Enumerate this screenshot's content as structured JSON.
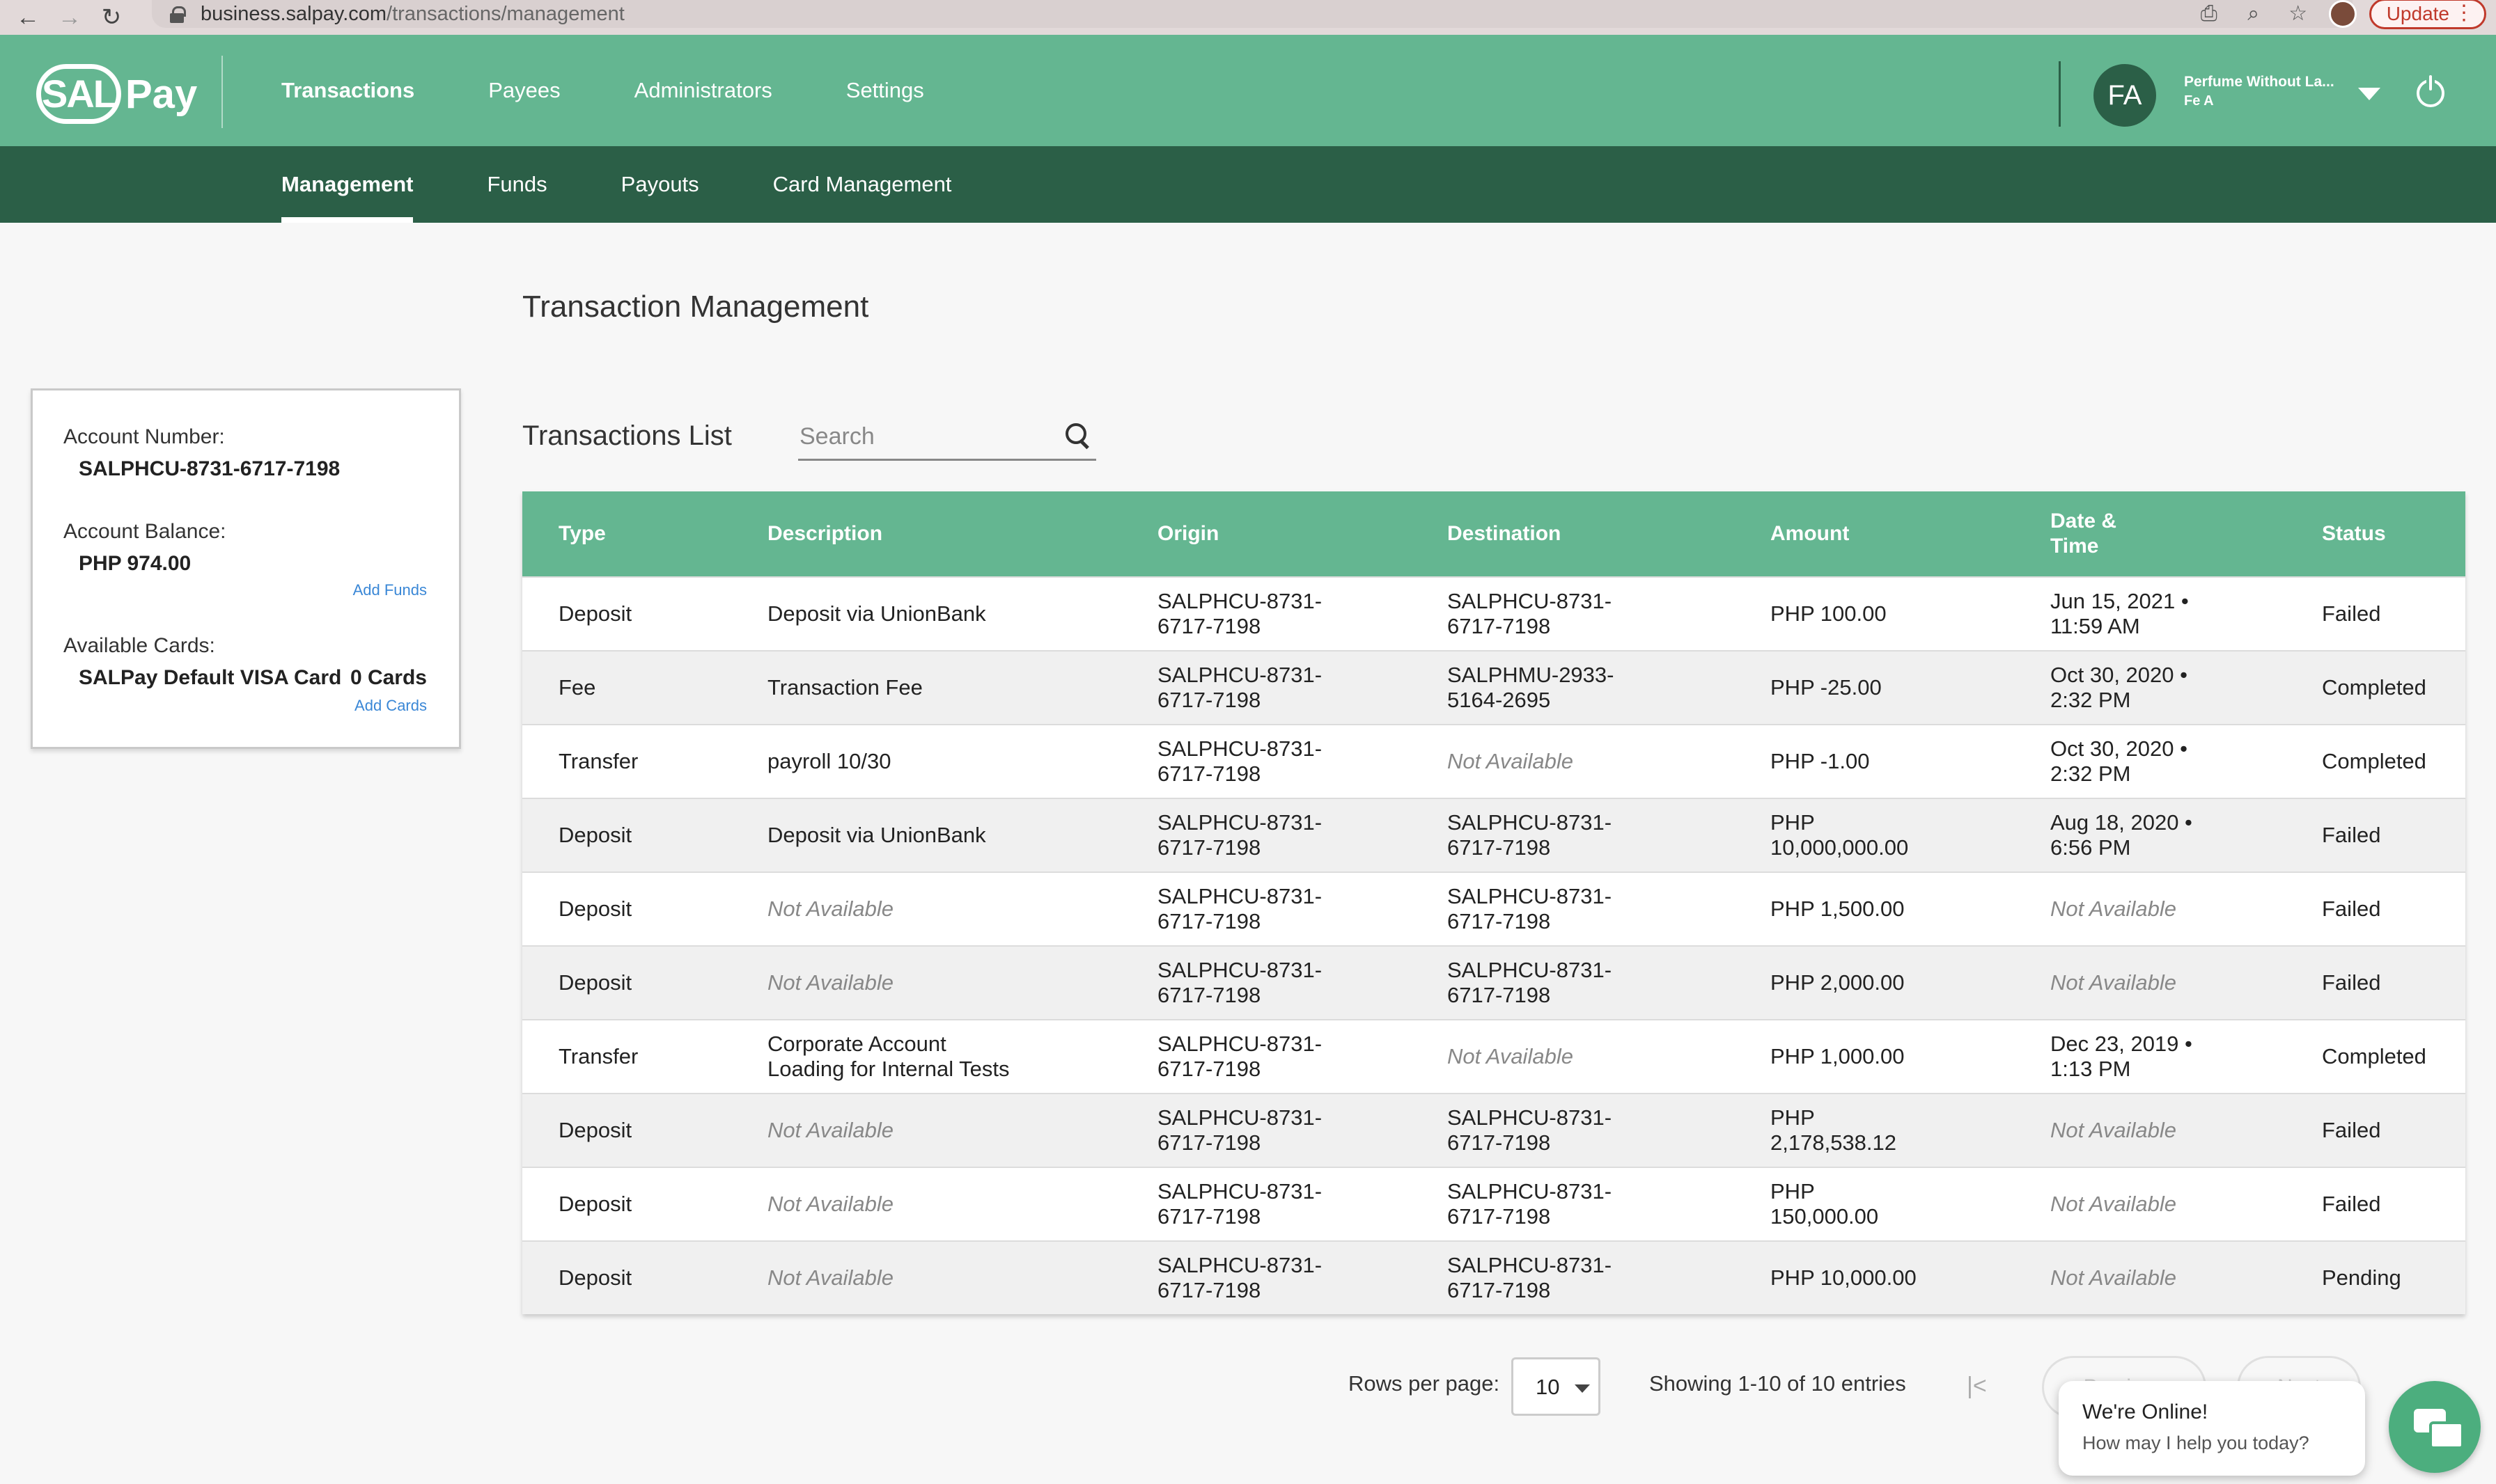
{
  "browser": {
    "url_host": "business.salpay.com",
    "url_path": "/transactions/management",
    "update_label": "Update"
  },
  "header": {
    "logo_sal": "SAL",
    "logo_pay": "Pay",
    "nav": [
      "Transactions",
      "Payees",
      "Administrators",
      "Settings"
    ],
    "user_initials": "FA",
    "user_name": "Perfume Without La...",
    "user_sub": "Fe A"
  },
  "subnav": [
    "Management",
    "Funds",
    "Payouts",
    "Card Management"
  ],
  "page": {
    "title": "Transaction Management"
  },
  "account": {
    "number_label": "Account Number:",
    "number": "SALPHCU-8731-6717-7198",
    "balance_label": "Account Balance:",
    "balance": "PHP 974.00",
    "add_funds": "Add Funds",
    "cards_label": "Available Cards:",
    "card_name": "SALPay Default VISA Card",
    "card_count": "0 Cards",
    "add_cards": "Add Cards"
  },
  "list": {
    "title": "Transactions List",
    "search_placeholder": "Search",
    "columns": [
      "Type",
      "Description",
      "Origin",
      "Destination",
      "Amount",
      "Date &\nTime",
      "Status"
    ],
    "rows": [
      {
        "type": "Deposit",
        "desc": "Deposit via UnionBank",
        "origin": "SALPHCU-8731-\n6717-7198",
        "dest": "SALPHCU-8731-\n6717-7198",
        "amount": "PHP 100.00",
        "date": "Jun 15, 2021 •\n11:59 AM",
        "status": "Failed"
      },
      {
        "type": "Fee",
        "desc": "Transaction Fee",
        "origin": "SALPHCU-8731-\n6717-7198",
        "dest": "SALPHMU-2933-\n5164-2695",
        "amount": "PHP -25.00",
        "date": "Oct 30, 2020 •\n2:32 PM",
        "status": "Completed"
      },
      {
        "type": "Transfer",
        "desc": "payroll 10/30",
        "origin": "SALPHCU-8731-\n6717-7198",
        "dest": "Not Available",
        "amount": "PHP -1.00",
        "date": "Oct 30, 2020 •\n2:32 PM",
        "status": "Completed"
      },
      {
        "type": "Deposit",
        "desc": "Deposit via UnionBank",
        "origin": "SALPHCU-8731-\n6717-7198",
        "dest": "SALPHCU-8731-\n6717-7198",
        "amount": "PHP\n10,000,000.00",
        "date": "Aug 18, 2020 •\n6:56 PM",
        "status": "Failed"
      },
      {
        "type": "Deposit",
        "desc": "Not Available",
        "origin": "SALPHCU-8731-\n6717-7198",
        "dest": "SALPHCU-8731-\n6717-7198",
        "amount": "PHP 1,500.00",
        "date": "Not Available",
        "status": "Failed"
      },
      {
        "type": "Deposit",
        "desc": "Not Available",
        "origin": "SALPHCU-8731-\n6717-7198",
        "dest": "SALPHCU-8731-\n6717-7198",
        "amount": "PHP 2,000.00",
        "date": "Not Available",
        "status": "Failed"
      },
      {
        "type": "Transfer",
        "desc": "Corporate Account\nLoading for Internal Tests",
        "origin": "SALPHCU-8731-\n6717-7198",
        "dest": "Not Available",
        "amount": "PHP 1,000.00",
        "date": "Dec 23, 2019 •\n1:13 PM",
        "status": "Completed"
      },
      {
        "type": "Deposit",
        "desc": "Not Available",
        "origin": "SALPHCU-8731-\n6717-7198",
        "dest": "SALPHCU-8731-\n6717-7198",
        "amount": "PHP\n2,178,538.12",
        "date": "Not Available",
        "status": "Failed"
      },
      {
        "type": "Deposit",
        "desc": "Not Available",
        "origin": "SALPHCU-8731-\n6717-7198",
        "dest": "SALPHCU-8731-\n6717-7198",
        "amount": "PHP\n150,000.00",
        "date": "Not Available",
        "status": "Failed"
      },
      {
        "type": "Deposit",
        "desc": "Not Available",
        "origin": "SALPHCU-8731-\n6717-7198",
        "dest": "SALPHCU-8731-\n6717-7198",
        "amount": "PHP 10,000.00",
        "date": "Not Available",
        "status": "Pending"
      }
    ]
  },
  "pagination": {
    "rows_label": "Rows per page:",
    "rows_value": "10",
    "showing": "Showing 1-10 of 10 entries",
    "prev": "Previous",
    "next": "Next"
  },
  "chat": {
    "title": "We're Online!",
    "subtitle": "How may I help you today?"
  },
  "colors": {
    "primary": "#64b691",
    "dark": "#2b5f47",
    "link": "#3a87d6"
  }
}
